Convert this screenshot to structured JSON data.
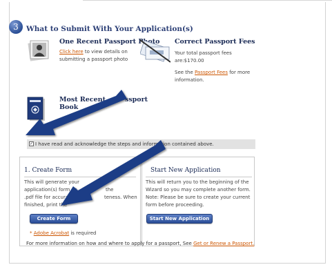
{
  "step": {
    "number": "3",
    "title": "What to Submit With Your Application(s)"
  },
  "photo": {
    "heading": "One Recent Passport Photo",
    "link": "Click here",
    "text_after_link": " to view details on",
    "line2": "submitting a passport photo"
  },
  "fees": {
    "heading": "Correct Passport Fees",
    "line1": "Your total passport fees",
    "line2": "are:$170.00",
    "see_prefix": "See the ",
    "link": "Passport Fees",
    "see_suffix": " for more",
    "line4": "information."
  },
  "passport_book": {
    "heading_line1": "Most Recent",
    "heading_line1b": "ssport",
    "heading_line2": "Book"
  },
  "acknowledge": {
    "checked": true,
    "check_glyph": "✓",
    "text": "I have read and acknowledge the steps and information contained above."
  },
  "create_form": {
    "heading": "1. Create Form",
    "lines": [
      "This will generate your",
      "application(s) form as",
      ".pdf file for accurac",
      "finished, print the"
    ],
    "lines_right": [
      "...",
      "the",
      "teness. When",
      ""
    ],
    "button": "Create Form",
    "note_prefix": "* ",
    "note_link": "Adobe Acrobat",
    "note_suffix": " is required"
  },
  "new_application": {
    "heading": "Start New Application",
    "lines": [
      "This will return you to the beginning of the",
      "Wizard so you may complete another form.",
      "Note: Please be sure to create your current",
      "form before proceeding."
    ],
    "button": "Start New Application"
  },
  "footer": {
    "prefix": "For more information on how and where to apply for a passport, See ",
    "link": "Get or Renew a Passport."
  },
  "colors": {
    "link": "#cc5500",
    "button": "#2c4f98",
    "heading": "#1a2a55",
    "arrow": "#1d3e86"
  }
}
